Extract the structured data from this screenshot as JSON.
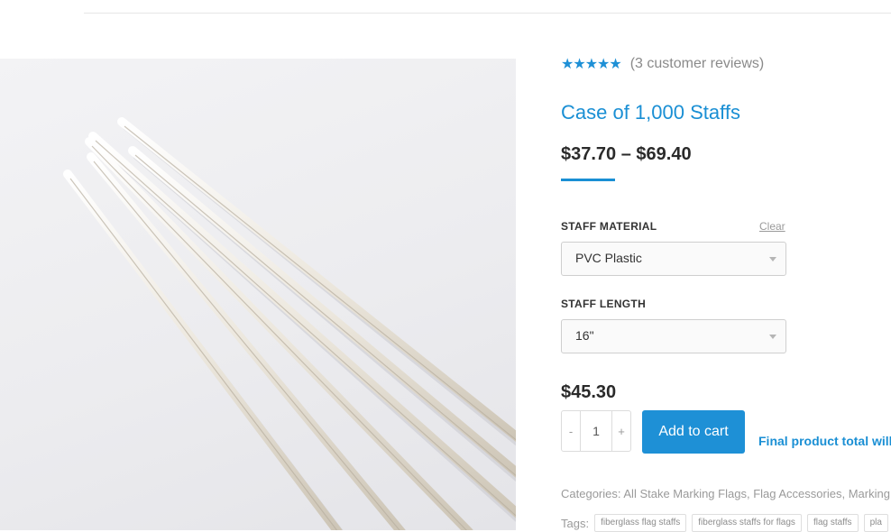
{
  "product": {
    "rating_stars": "★★★★★",
    "review_text": "(3 customer reviews)",
    "title": "Case of 1,000 Staffs",
    "price_range": "$37.70 – $69.40",
    "accent_color": "#1a8fd4"
  },
  "variations": {
    "material_label": "STAFF MATERIAL",
    "clear_label": "Clear",
    "material_value": "PVC Plastic",
    "length_label": "STAFF LENGTH",
    "length_value": "16\""
  },
  "cart": {
    "variation_price": "$45.30",
    "qty_minus": "-",
    "qty_value": "1",
    "qty_plus": "+",
    "add_to_cart_label": "Add to cart",
    "final_note": "Final product total will"
  },
  "meta": {
    "categories_label": "Categories:",
    "categories": [
      "All Stake Marking Flags",
      "Flag Accessories",
      "Marking A"
    ],
    "tags_label": "Tags:",
    "tags": [
      "fiberglass flag staffs",
      "fiberglass staffs for flags",
      "flag staffs",
      "pla"
    ]
  },
  "image": {
    "icon": "product-photo-staffs"
  }
}
